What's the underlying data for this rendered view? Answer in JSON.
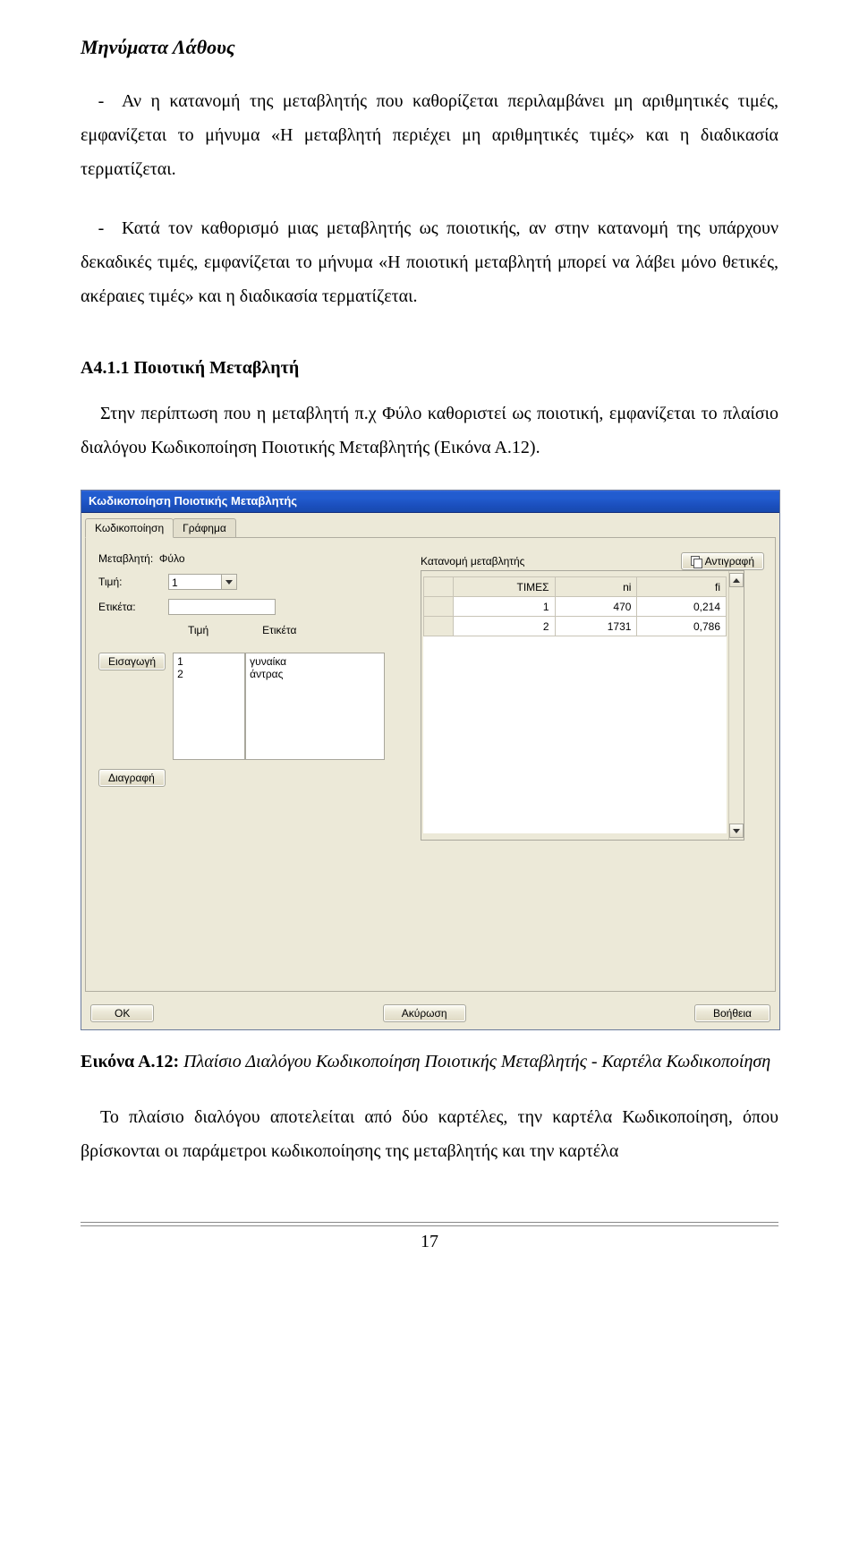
{
  "doc": {
    "sectionTitle": "Μηνύματα Λάθους",
    "bullet1": "Αν η κατανομή της μεταβλητής που καθορίζεται περιλαμβάνει μη αριθμητικές τιμές, εμφανίζεται το μήνυμα «Η μεταβλητή περιέχει μη αριθμητικές τιμές» και η διαδικασία τερματίζεται.",
    "bullet2": "Κατά τον καθορισμό μιας μεταβλητής ως ποιοτικής, αν στην κατανομή της υπάρχουν δεκαδικές τιμές, εμφανίζεται το μήνυμα «Η ποιοτική μεταβλητή μπορεί να λάβει μόνο θετικές, ακέραιες τιμές» και η διαδικασία τερματίζεται.",
    "subhead": "Α4.1.1 Ποιοτική Μεταβλητή",
    "subpara": "Στην περίπτωση που η μεταβλητή π.χ Φύλο καθοριστεί ως ποιοτική, εμφανίζεται το πλαίσιο διαλόγου Κωδικοποίηση Ποιοτικής Μεταβλητής (Εικόνα Α.12).",
    "captionLead": "Εικόνα Α.12:",
    "captionRest": " Πλαίσιο Διαλόγου Κωδικοποίηση Ποιοτικής Μεταβλητής - Καρτέλα Κωδικοποίηση",
    "followPara": "Το πλαίσιο διαλόγου αποτελείται από δύο καρτέλες, την καρτέλα Κωδικοποίηση, όπου βρίσκονται οι παράμετροι κωδικοποίησης της μεταβλητής και την καρτέλα",
    "pageNum": "17",
    "dash": "-"
  },
  "dialog": {
    "title": "Κωδικοποίηση Ποιοτικής Μεταβλητής",
    "tabs": {
      "tab1": "Κωδικοποίηση",
      "tab2": "Γράφημα"
    },
    "left": {
      "varlabel": "Μεταβλητή:",
      "varname": "Φύλο",
      "timilabel": "Τιμή:",
      "timivalue": "1",
      "etiketalabel": "Ετικέτα:",
      "etiketavalue": "",
      "colTimi": "Τιμή",
      "colEtiketa": "Ετικέτα",
      "btnInsert": "Εισαγωγή",
      "btnDelete": "Διαγραφή",
      "listTimi": [
        "1",
        "2"
      ],
      "listEtiketa": [
        "γυναίκα",
        "άντρας"
      ]
    },
    "right": {
      "title": "Κατανομή μεταβλητής",
      "btnCopy": "Αντιγραφή",
      "headers": {
        "h1": "ΤΙΜΕΣ",
        "h2": "ni",
        "h3": "fi"
      },
      "rows": [
        {
          "v": "1",
          "ni": "470",
          "fi": "0,214"
        },
        {
          "v": "2",
          "ni": "1731",
          "fi": "0,786"
        }
      ]
    },
    "buttons": {
      "ok": "OK",
      "cancel": "Ακύρωση",
      "help": "Βοήθεια"
    }
  }
}
